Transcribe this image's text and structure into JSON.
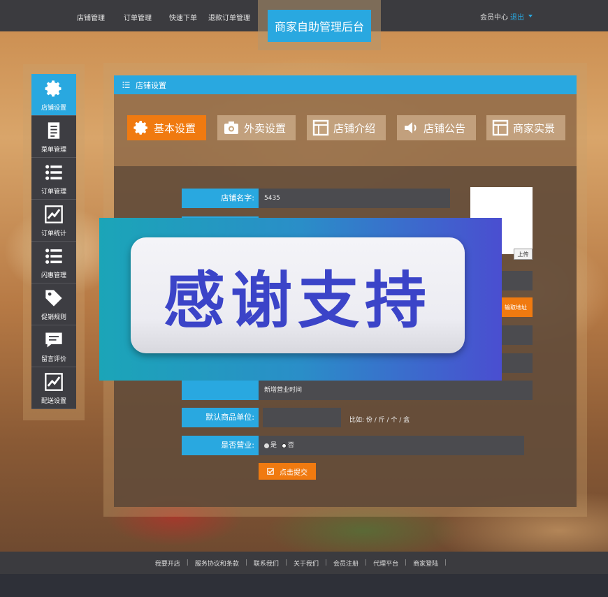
{
  "topnav": {
    "items": [
      "店铺管理",
      "订单管理",
      "快速下单",
      "退款订单管理"
    ],
    "brand": "商家自助管理后台",
    "member_label": "会员中心",
    "logout_label": "退出"
  },
  "sidebar": {
    "items": [
      {
        "label": "店铺设置",
        "icon": "gear-icon",
        "active": true
      },
      {
        "label": "菜单管理",
        "icon": "document-icon"
      },
      {
        "label": "订单管理",
        "icon": "list-icon"
      },
      {
        "label": "订单统计",
        "icon": "chart-icon"
      },
      {
        "label": "闪惠管理",
        "icon": "list-icon"
      },
      {
        "label": "促销规则",
        "icon": "tag-icon"
      },
      {
        "label": "留言评价",
        "icon": "comment-icon"
      },
      {
        "label": "配送设置",
        "icon": "chart-icon"
      }
    ]
  },
  "panel": {
    "title": "店铺设置",
    "tabs": [
      {
        "label": "基本设置",
        "icon": "gear-icon",
        "active": true
      },
      {
        "label": "外卖设置",
        "icon": "camera-icon"
      },
      {
        "label": "店铺介绍",
        "icon": "layout-icon"
      },
      {
        "label": "店铺公告",
        "icon": "speaker-icon"
      },
      {
        "label": "商家实景",
        "icon": "layout-icon"
      }
    ]
  },
  "form": {
    "shop_name_label": "店铺名字:",
    "shop_name_value": "5435",
    "upload_label": "上传",
    "address_button": "输取地址",
    "business_hours_add": "新增营业时间",
    "unit_label": "默认商品单位:",
    "unit_hint": "比如: 份 / 斤 / 个 / 盒",
    "open_label": "是否营业:",
    "open_options": [
      "是",
      "否"
    ],
    "open_selected": "否",
    "submit_label": "点击提交"
  },
  "banner": {
    "text": "感谢支持"
  },
  "footer": {
    "links": [
      "我要开店",
      "服务协议和条款",
      "联系我们",
      "关于我们",
      "会员注册",
      "代理平台",
      "商家登陆"
    ]
  },
  "colors": {
    "accent_blue": "#29a8e0",
    "accent_orange": "#f07a10",
    "banner_text": "#3b44c8"
  }
}
